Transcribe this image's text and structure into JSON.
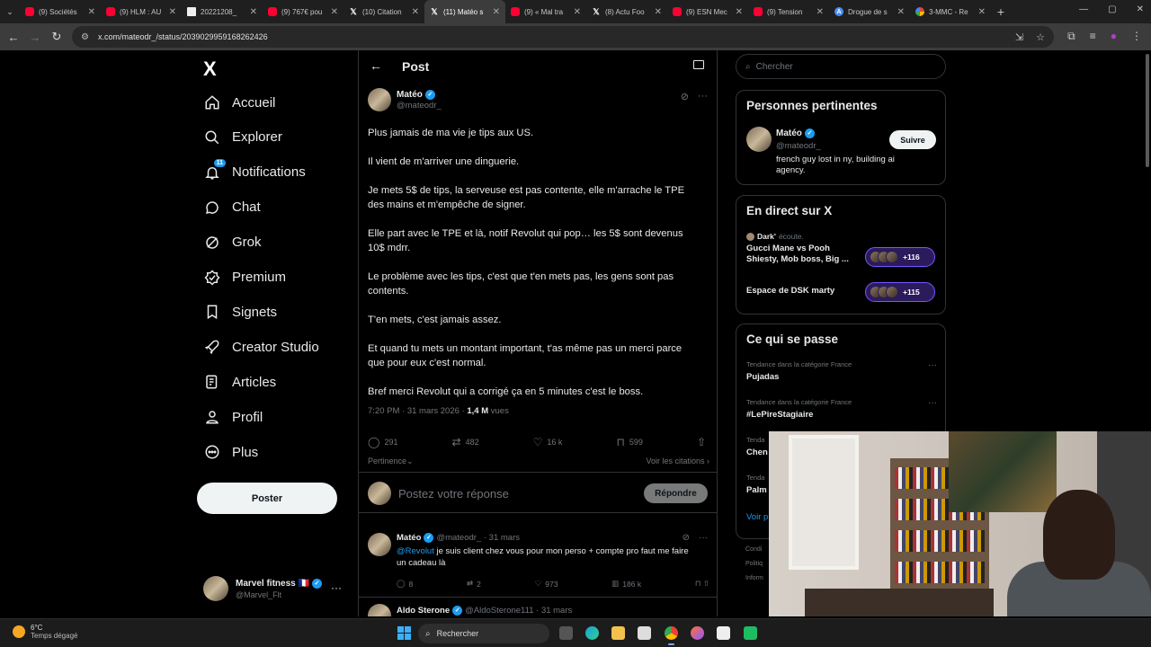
{
  "browser": {
    "tabs": [
      {
        "title": "(9) Sociétés",
        "icon": "youtube-icon",
        "fav": "yt"
      },
      {
        "title": "(9) HLM : AU",
        "icon": "youtube-icon",
        "fav": "yt"
      },
      {
        "title": "20221208_",
        "icon": "document-icon",
        "fav": "doc"
      },
      {
        "title": "(9) 767€ pou",
        "icon": "youtube-icon",
        "fav": "yt"
      },
      {
        "title": "(10) Citation",
        "icon": "x-icon",
        "fav": "x"
      },
      {
        "title": "(11) Matéo s",
        "icon": "x-icon",
        "fav": "x",
        "active": true
      },
      {
        "title": "(9) « Mal tra",
        "icon": "youtube-icon",
        "fav": "yt"
      },
      {
        "title": "(8) Actu Foo",
        "icon": "x-icon",
        "fav": "x"
      },
      {
        "title": "(9) ESN Mec",
        "icon": "youtube-icon",
        "fav": "yt"
      },
      {
        "title": "(9) Tension",
        "icon": "youtube-icon",
        "fav": "yt"
      },
      {
        "title": "Drogue de s",
        "icon": "a-icon",
        "fav": "a"
      },
      {
        "title": "3-MMC - Re",
        "icon": "google-icon",
        "fav": "g"
      }
    ],
    "url": "x.com/mateodr_/status/2039029959168262426"
  },
  "nav": {
    "logo": "X",
    "items": [
      {
        "label": "Accueil",
        "icon": "home-icon"
      },
      {
        "label": "Explorer",
        "icon": "search-icon"
      },
      {
        "label": "Notifications",
        "icon": "bell-icon",
        "badge": "11"
      },
      {
        "label": "Chat",
        "icon": "chat-icon"
      },
      {
        "label": "Grok",
        "icon": "grok-icon"
      },
      {
        "label": "Premium",
        "icon": "premium-icon"
      },
      {
        "label": "Signets",
        "icon": "bookmark-icon"
      },
      {
        "label": "Creator Studio",
        "icon": "rocket-icon"
      },
      {
        "label": "Articles",
        "icon": "articles-icon"
      },
      {
        "label": "Profil",
        "icon": "person-icon"
      },
      {
        "label": "Plus",
        "icon": "more-circle-icon"
      }
    ],
    "post_button": "Poster",
    "account": {
      "name": "Marvel fitness 🇫🇷",
      "handle": "@Marvel_Flt"
    }
  },
  "main": {
    "header": {
      "title": "Post"
    },
    "post": {
      "author": "Matéo",
      "handle": "@mateodr_",
      "paragraphs": [
        "Plus jamais de ma vie je tips aux US.",
        "Il vient de m'arriver une dinguerie.",
        "Je mets 5$ de tips, la serveuse est pas contente, elle m'arrache le TPE des mains et m'empêche de signer.",
        "Elle part avec le TPE et là, notif Revolut qui pop… les 5$ sont devenus 10$ mdrr.",
        "Le problème avec les tips, c'est que t'en mets pas, les gens sont pas contents.",
        "T'en mets, c'est jamais assez.",
        "Et quand tu mets un montant important, t'as même pas un merci parce que pour eux c'est normal.",
        "Bref merci Revolut qui a corrigé ça en 5 minutes c'est le boss."
      ],
      "time": "7:20 PM · 31 mars 2026 · ",
      "views": "1,4 M",
      "views_label": " vues",
      "stats": {
        "replies": "291",
        "reposts": "482",
        "likes": "16 k",
        "bookmarks": "599"
      },
      "sort_label": "Pertinence",
      "quotes_label": "Voir les citations"
    },
    "reply_box": {
      "placeholder": "Postez votre réponse",
      "button": "Répondre"
    },
    "replies": [
      {
        "author": "Matéo",
        "handle": "@mateodr_ · 31 mars",
        "mention": "@Revolut",
        "text": " je suis client chez vous pour mon perso + compte pro faut me faire un cadeau là",
        "replies": "8",
        "reposts": "2",
        "likes": "973",
        "views": "186 k"
      },
      {
        "author": "Aldo Sterone",
        "handle": "@AldoSterone111 · 31 mars"
      }
    ]
  },
  "right": {
    "search_placeholder": "Chercher",
    "related": {
      "title": "Personnes pertinentes",
      "name": "Matéo",
      "handle": "@mateodr_",
      "bio": "french guy lost in ny, building ai agency.",
      "follow": "Suivre"
    },
    "live": {
      "title": "En direct sur X",
      "spaces": [
        {
          "host": "Dark'",
          "host_suffix": "écoute.",
          "title": "Gucci Mane vs Pooh Shiesty, Mob boss, Big ...",
          "count": "+116"
        },
        {
          "title": "Espace de DSK marty",
          "count": "+115"
        }
      ]
    },
    "happening": {
      "title": "Ce qui se passe",
      "trends": [
        {
          "category": "Tendance dans la catégorie France",
          "name": "Pujadas"
        },
        {
          "category": "Tendance dans la catégorie France",
          "name": "#LePireStagiaire"
        },
        {
          "category": "Tenda",
          "name": "Chen"
        },
        {
          "category": "Tenda",
          "name": "Palm"
        }
      ],
      "see_more": "Voir p"
    },
    "footer": [
      "Condi",
      "Politiq",
      "Inform"
    ]
  },
  "taskbar": {
    "temp": "6°C",
    "weather": "Temps dégagé",
    "search": "Rechercher"
  }
}
